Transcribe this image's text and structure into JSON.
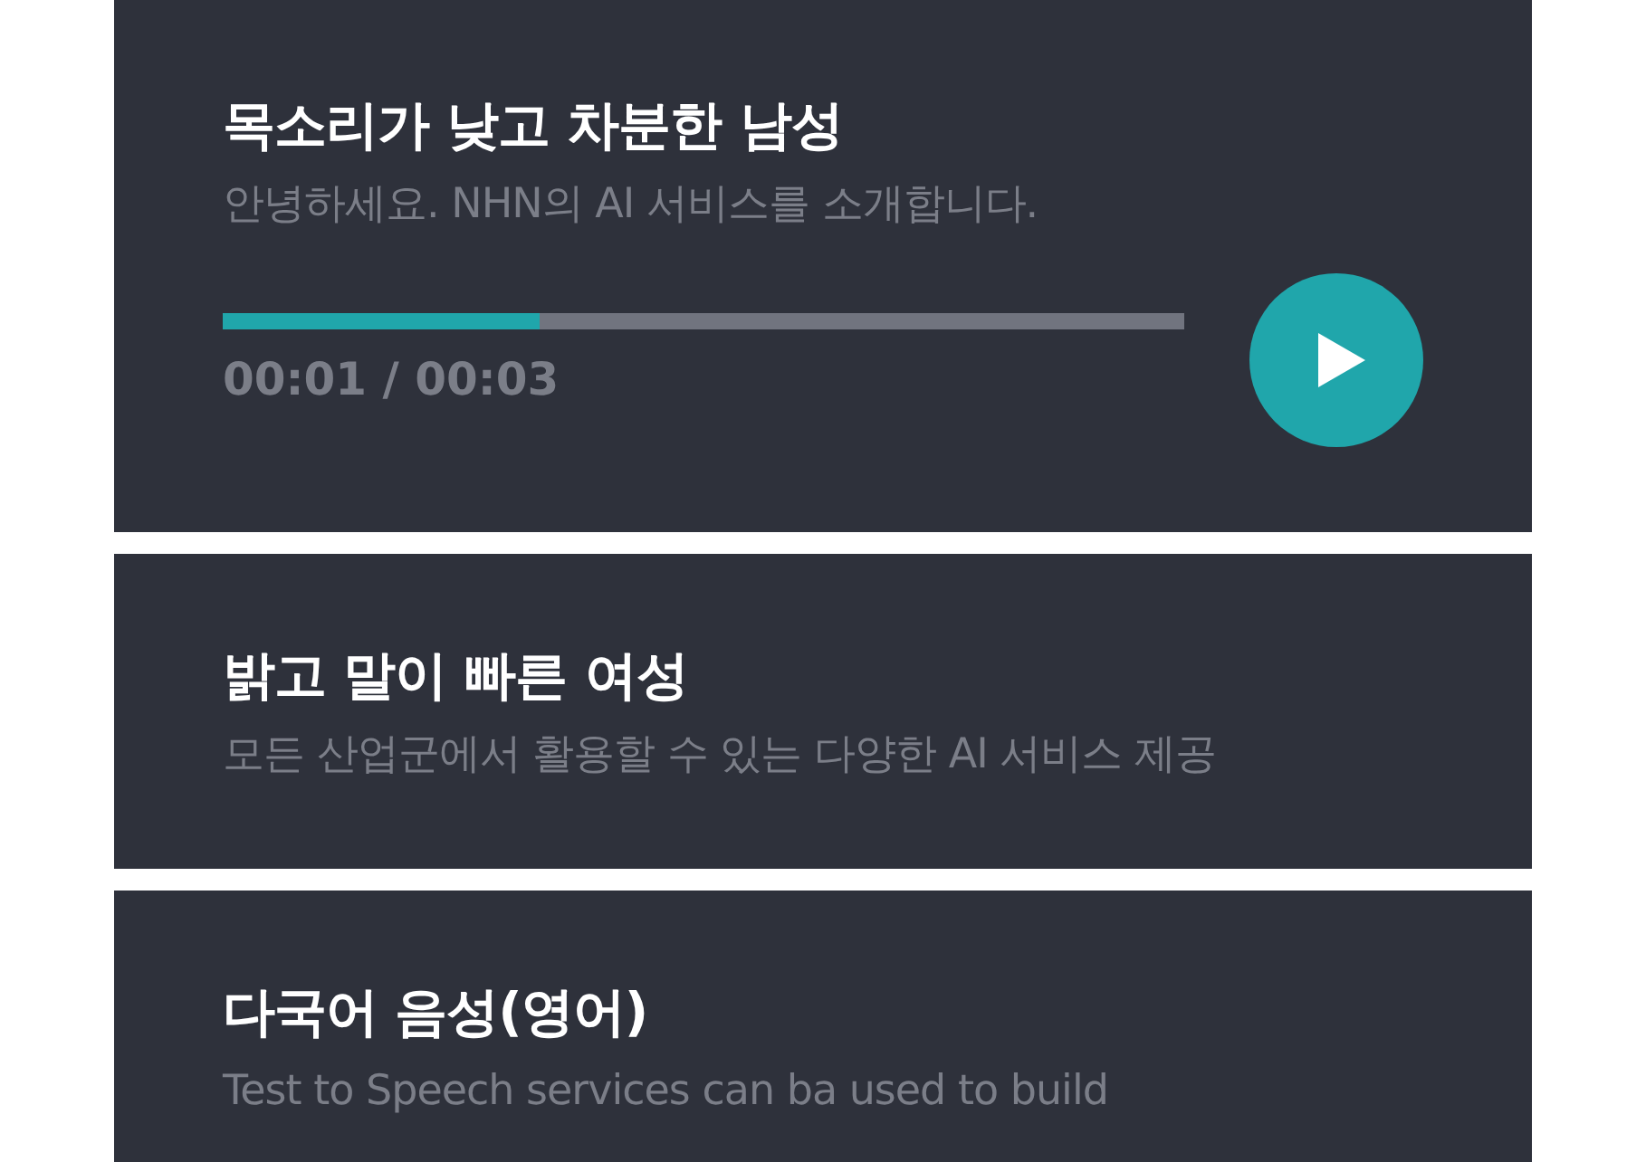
{
  "voices": [
    {
      "title": "목소리가 낮고 차분한 남성",
      "description": "안녕하세요. NHN의 AI 서비스를 소개합니다.",
      "player": {
        "level": 0.33,
        "time": "00:01 / 00:03",
        "playing": false
      }
    },
    {
      "title": "밝고 말이 빠른 여성",
      "description": "모든 산업군에서 활용할 수 있는 다양한 AI 서비스 제공"
    },
    {
      "title": "다국어 음성(영어)",
      "description": "Test to Speech services can ba used to build"
    }
  ]
}
